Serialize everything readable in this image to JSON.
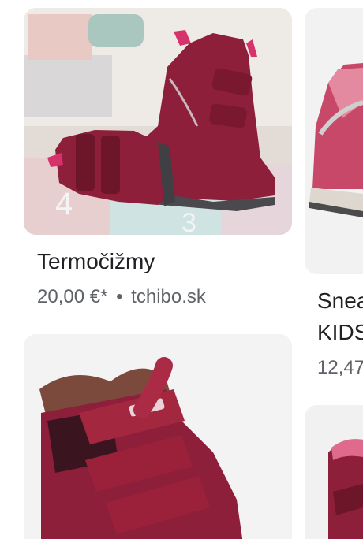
{
  "results": [
    {
      "title": "Termočižmy",
      "price": "20,00 €*",
      "separator": "•",
      "source": "tchibo.sk",
      "image_icon": "red-kids-winter-boots-image"
    },
    {
      "title_line1": "Snea",
      "title_line2": "KIDS",
      "price": "12,47",
      "image_icon": "pink-sneaker-image"
    },
    {
      "image_icon": "burgundy-velcro-boot-image"
    },
    {
      "image_icon": "pink-boot-partial-image"
    }
  ],
  "colors": {
    "title": "#202124",
    "meta": "#5f6368",
    "boot_main": "#8e1f3a",
    "boot_dark": "#5d1024",
    "accent_pink": "#d6336c"
  }
}
